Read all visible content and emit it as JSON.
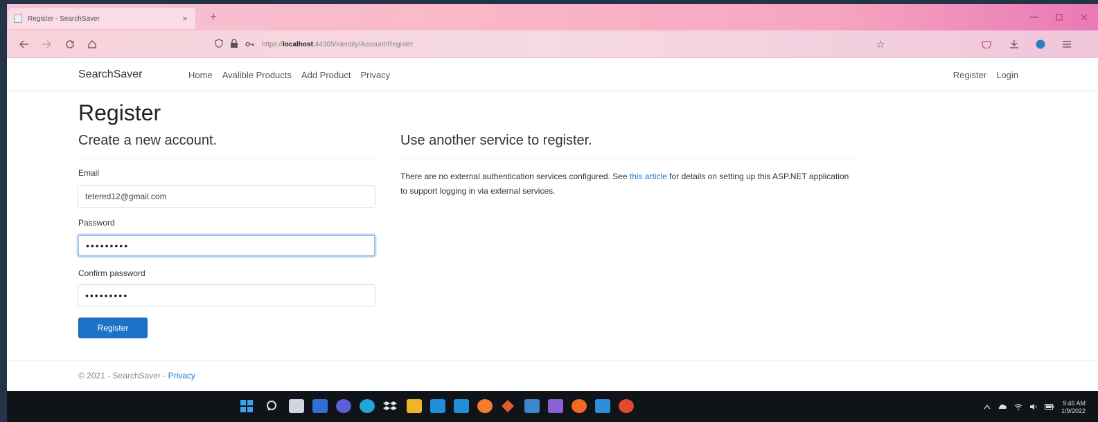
{
  "browser": {
    "tab_title": "Register - SearchSaver",
    "tab_close": "×",
    "new_tab": "+",
    "url_prefix": "https://",
    "url_host": "localhost",
    "url_rest": ":44305/Identity/Account/Register"
  },
  "site": {
    "brand": "SearchSaver",
    "nav": [
      "Home",
      "Avalible Products",
      "Add Product",
      "Privacy"
    ],
    "nav_right": [
      "Register",
      "Login"
    ]
  },
  "form": {
    "title": "Register",
    "subtitle": "Create a new account.",
    "email_label": "Email",
    "email_value": "tetered12@gmail.com",
    "password_label": "Password",
    "password_value": "•••••••••",
    "confirm_label": "Confirm password",
    "confirm_value": "•••••••••",
    "submit_label": "Register"
  },
  "external": {
    "title": "Use another service to register.",
    "text_before": "There are no external authentication services configured. See ",
    "link": "this article",
    "text_after": " for details on setting up this ASP.NET application to support logging in via external services."
  },
  "footer": {
    "copyright": "© 2021 - SearchSaver - ",
    "privacy": "Privacy"
  },
  "taskbar": {
    "time": "9:46 AM",
    "date": "1/9/2022"
  },
  "colors": {
    "accent": "#1b73c8",
    "taskbar": "#101318"
  }
}
